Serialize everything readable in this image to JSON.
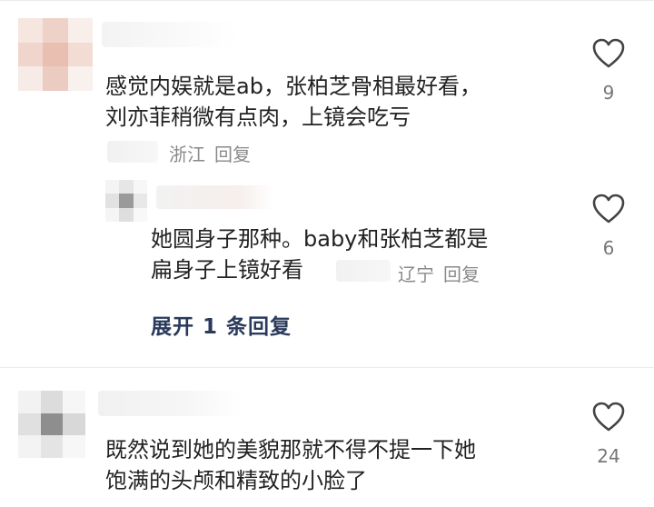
{
  "comments": [
    {
      "text_lines": [
        "感觉内娱就是ab，张柏芝骨相最好看，",
        "刘亦菲稍微有点肉，上镜会吃亏"
      ],
      "location": "浙江",
      "reply_label": "回复",
      "likes": "9"
    },
    {
      "text_lines": [
        "她圆身子那种。baby和张柏芝都是",
        "扁身子上镜好看"
      ],
      "location": "辽宁",
      "reply_label": "回复",
      "likes": "6",
      "expand_label": "展开 1 条回复"
    },
    {
      "text_lines": [
        "既然说到她的美貌那就不得不提一下她",
        "饱满的头颅和精致的小脸了"
      ],
      "likes": "24"
    }
  ],
  "icons": {
    "like": "heart-outline-icon"
  },
  "colors": {
    "meta": "#8a8a8a",
    "expand": "#2a3a5c",
    "divider": "#ececec"
  }
}
